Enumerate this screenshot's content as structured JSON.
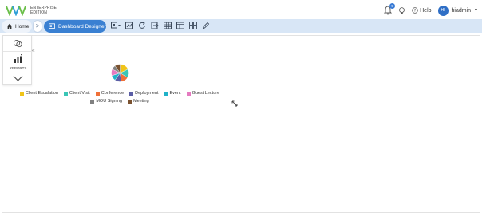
{
  "header": {
    "edition_line1": "ENTERPRISE",
    "edition_line2": "EDITION",
    "notification_count": "5",
    "help_label": "Help",
    "avatar_initials": "HI",
    "username": "hiadmin"
  },
  "toolbar": {
    "home_label": "Home",
    "separator": ">",
    "designer_label": "Dashboard Designer"
  },
  "side_panel": {
    "reports_label": "REPORTS",
    "report_peek": "ort"
  },
  "colors": {
    "accent": "#3a80d2",
    "toolbar_bg": "#d8e6f6"
  },
  "chart_data": {
    "type": "pie",
    "title": "",
    "categories": [
      "Client Escalation",
      "Client Visit",
      "Conference",
      "Deployment",
      "Event",
      "Guest Lecture",
      "MOU Signing",
      "Meeting"
    ],
    "values": [
      18,
      16,
      14,
      12,
      10,
      12,
      8,
      10
    ],
    "colors": [
      "#f0c419",
      "#3ac6b6",
      "#f07038",
      "#5b5ea6",
      "#20b2c8",
      "#e57ac0",
      "#808080",
      "#7a5230"
    ],
    "legend_placement": "bottom"
  }
}
